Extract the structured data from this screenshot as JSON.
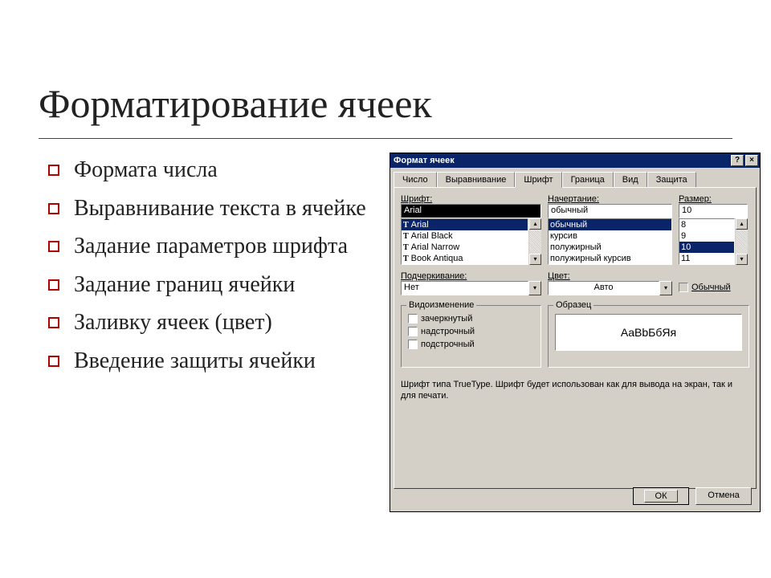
{
  "slide": {
    "title": "Форматирование ячеек",
    "bullets": [
      "Формата числа",
      "Выравнивание текста в ячейке",
      "Задание параметров шрифта",
      "Задание границ ячейки",
      "Заливку ячеек (цвет)",
      "Введение защиты ячейки"
    ]
  },
  "dialog": {
    "title": "Формат ячеек",
    "tabs": [
      "Число",
      "Выравнивание",
      "Шрифт",
      "Граница",
      "Вид",
      "Защита"
    ],
    "active_tab": "Шрифт",
    "font_label": "Шрифт:",
    "font_value": "Arial",
    "font_list": [
      "Arial",
      "Arial Black",
      "Arial Narrow",
      "Book Antiqua"
    ],
    "font_list_selected": "Arial",
    "style_label": "Начертание:",
    "style_value": "обычный",
    "style_list": [
      "обычный",
      "курсив",
      "полужирный",
      "полужирный курсив"
    ],
    "style_list_selected": "обычный",
    "size_label": "Размер:",
    "size_value": "10",
    "size_list": [
      "8",
      "9",
      "10",
      "11"
    ],
    "size_list_selected": "10",
    "underline_label": "Подчеркивание:",
    "underline_value": "Нет",
    "color_label": "Цвет:",
    "color_value": "Авто",
    "normal_checkbox": "Обычный",
    "effects_group": "Видоизменение",
    "effects": [
      "зачеркнутый",
      "надстрочный",
      "подстрочный"
    ],
    "preview_group": "Образец",
    "preview_text": "AaBbБбЯя",
    "hint": "Шрифт типа TrueType. Шрифт будет использован как для вывода на экран, так и для печати.",
    "ok": "ОК",
    "cancel": "Отмена"
  }
}
